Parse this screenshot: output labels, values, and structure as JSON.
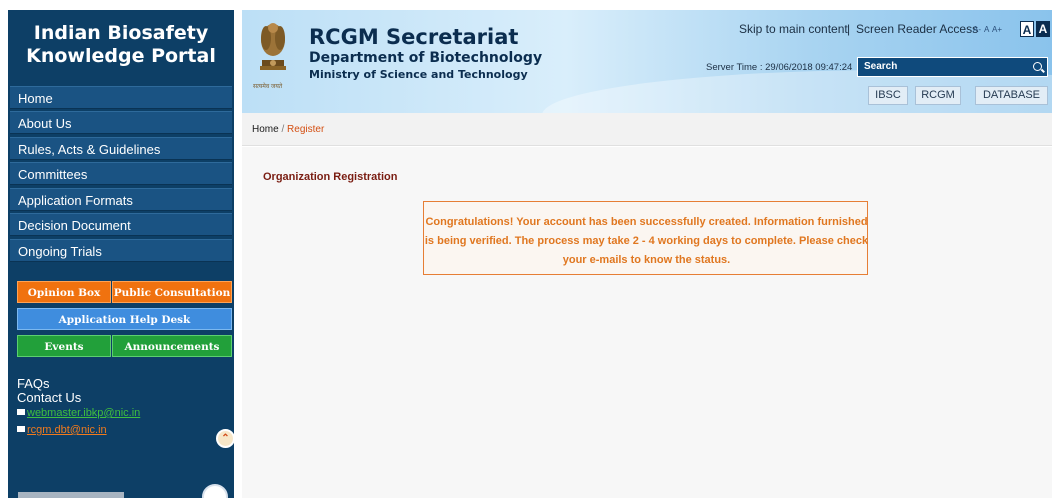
{
  "sidebar": {
    "title_line1": "Indian Biosafety",
    "title_line2": "Knowledge Portal",
    "nav": [
      {
        "label": "Home"
      },
      {
        "label": "About Us"
      },
      {
        "label": "Rules, Acts & Guidelines"
      },
      {
        "label": "Committees"
      },
      {
        "label": "Application Formats"
      },
      {
        "label": "Decision Document"
      },
      {
        "label": "Ongoing Trials"
      }
    ],
    "buttons": {
      "opinion_box": "Opinion Box",
      "public_consultation": "Public Consultation",
      "help_desk": "Application Help Desk",
      "events": "Events",
      "announcements": "Announcements"
    },
    "faqs": "FAQs",
    "contact_us": "Contact Us",
    "emails": [
      "webmaster.ibkp@nic.in",
      "rcgm.dbt@nic.in"
    ],
    "email_colors": [
      "#3fbf3f",
      "#f07a1d"
    ]
  },
  "header": {
    "org_name": "RCGM Secretariat",
    "department": "Department of Biotechnology",
    "ministry": "Ministry of Science and Technology",
    "emblem_caption": "सत्यमेव जयते",
    "skip_link": "Skip to main content",
    "separator": "|",
    "screen_reader": "Screen Reader Access",
    "font_sizes": [
      "A-",
      "A",
      "A+"
    ],
    "contrast": [
      "A",
      "A"
    ],
    "server_time": "Server Time : 29/06/2018 09:47:24",
    "search_placeholder": "Search",
    "tabs": [
      "IBSC",
      "RCGM",
      "DATABASE"
    ]
  },
  "breadcrumb": {
    "home": "Home",
    "separator": " / ",
    "current": "Register"
  },
  "main": {
    "heading": "Organization Registration",
    "success_message": "Congratulations! Your account has been successfully created. Information furnished is being verified. The process may take 2 - 4 working days to complete. Please check your e-mails to know the status."
  }
}
